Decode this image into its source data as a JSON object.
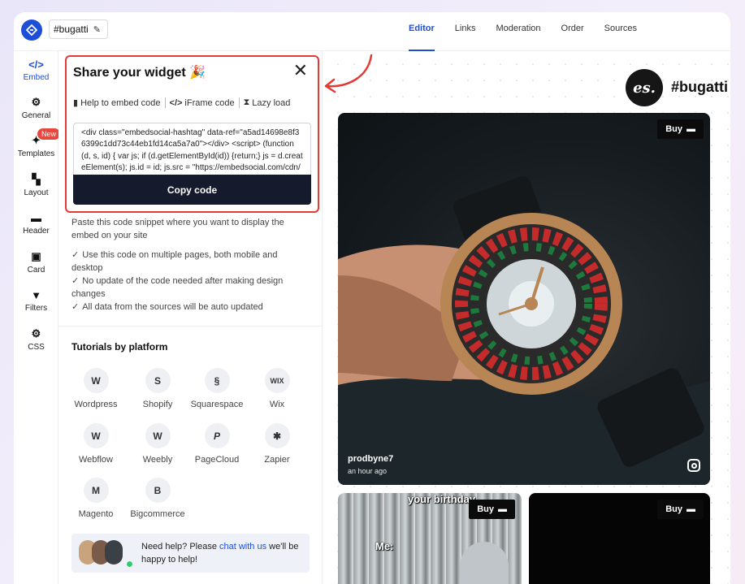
{
  "header": {
    "title": "#bugatti",
    "tabs": [
      {
        "label": "Editor",
        "active": true
      },
      {
        "label": "Links",
        "active": false
      },
      {
        "label": "Moderation",
        "active": false
      },
      {
        "label": "Order",
        "active": false
      },
      {
        "label": "Sources",
        "active": false
      }
    ]
  },
  "sidebar": {
    "items": [
      {
        "label": "Embed",
        "icon": "code-icon",
        "active": true
      },
      {
        "label": "General",
        "icon": "gear-icon"
      },
      {
        "label": "Templates",
        "icon": "sparkles-icon",
        "badge": "New"
      },
      {
        "label": "Layout",
        "icon": "layout-icon"
      },
      {
        "label": "Header",
        "icon": "header-icon"
      },
      {
        "label": "Card",
        "icon": "image-icon"
      },
      {
        "label": "Filters",
        "icon": "funnel-icon"
      },
      {
        "label": "CSS",
        "icon": "gear-icon"
      }
    ]
  },
  "share": {
    "title": "Share your widget 🎉",
    "tabs": [
      "Help to embed code",
      "iFrame code",
      "Lazy load"
    ],
    "code": "<div class=\"embedsocial-hashtag\" data-ref=\"a5ad14698e8f36399c1dd73c44eb1fd14ca5a7a0\"></div> <script> (function(d, s, id) { var js; if (d.getElementById(id)) {return;} js = d.createElement(s); js.id = id; js.src = \"https://embedsocial.com/cdn/ht.js\"; d.getElementsByTagName(\"head\")[0].appendChild(js); }(document, \"script\", \"EmbedSocialHashtagScript\"));",
    "copy_label": "Copy code"
  },
  "instructions": {
    "paste": "Paste this code snippet where you want to display the embed on your site",
    "checks": [
      "Use this code on multiple pages, both mobile and desktop",
      "No update of the code needed after making design changes",
      "All data from the sources will be auto updated"
    ]
  },
  "tutorials": {
    "title": "Tutorials by platform",
    "platforms": [
      {
        "label": "Wordpress",
        "glyph": "W"
      },
      {
        "label": "Shopify",
        "glyph": "S"
      },
      {
        "label": "Squarespace",
        "glyph": "§"
      },
      {
        "label": "Wix",
        "glyph": "WIX"
      },
      {
        "label": "Webflow",
        "glyph": "W"
      },
      {
        "label": "Weebly",
        "glyph": "W"
      },
      {
        "label": "PageCloud",
        "glyph": "P"
      },
      {
        "label": "Zapier",
        "glyph": "✱"
      },
      {
        "label": "Magento",
        "glyph": "M"
      },
      {
        "label": "Bigcommerce",
        "glyph": "B"
      }
    ]
  },
  "help": {
    "text_before": "Need help? Please ",
    "link": "chat with us",
    "text_after": " we'll be happy to help!"
  },
  "preview": {
    "logo_text": "es.",
    "hashtag": "#bugatti",
    "buy_label": "Buy",
    "main_post": {
      "user": "prodbyne7",
      "time": "an hour ago"
    },
    "meme": {
      "top": "your birthday",
      "bottom": "Me:"
    }
  },
  "colors": {
    "accent": "#1d4ed8",
    "highlight": "#e53935",
    "copy_button": "#151a2d",
    "badge": "#e4483e"
  }
}
